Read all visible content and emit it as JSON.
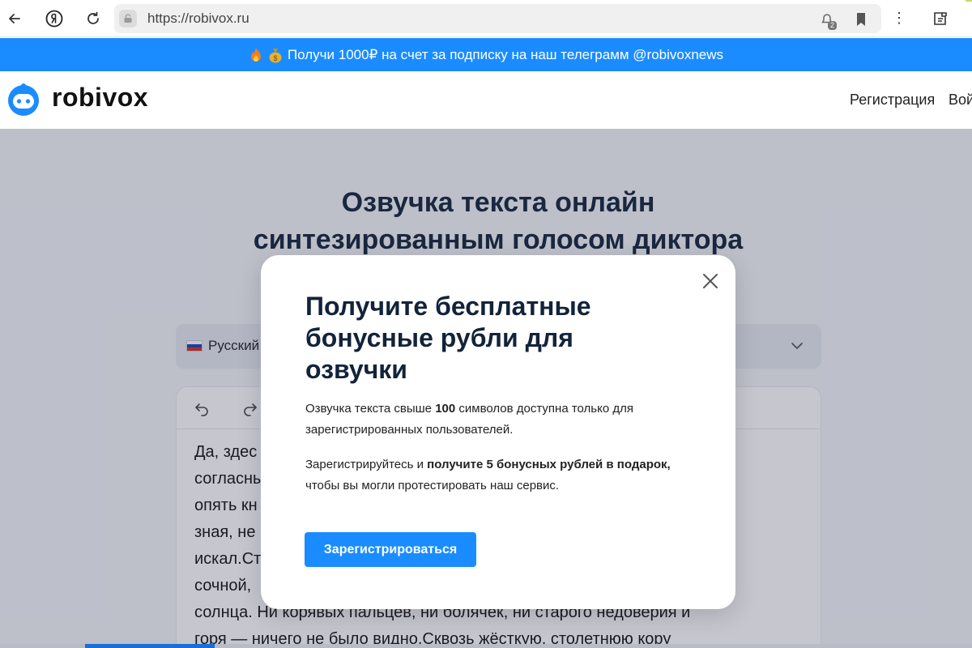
{
  "browser": {
    "url": "https://robivox.ru",
    "notif_count": "2",
    "menu_glyph": "⋮"
  },
  "promo": {
    "text": "Получи 1000₽ на счет за подписку на наш телеграмм @robivoxnews"
  },
  "header": {
    "logo_text": "robivox",
    "nav": [
      "Регистрация",
      "Вой"
    ]
  },
  "hero": {
    "title_line1": "Озвучка текста онлайн",
    "title_line2": "синтезированным голосом диктора"
  },
  "language_select": {
    "selected": "Русский"
  },
  "editor": {
    "text": "Да, здес\nсогласны\nопять кн                                                                                    е\nзная, не\nискал.Ст\nсочной, \nсолнца. Ни корявых пальцев, ни болячек, ни старого недоверия и\nгоря — ничего не было видно.Сквозь жёсткую, столетнюю кору"
  },
  "modal": {
    "title": "Получите бесплатные бонусные рубли для озвучки",
    "p1_before": "Озвучка текста свыше ",
    "p1_bold": "100",
    "p1_after": " символов доступна только для зарегистрированных пользователей.",
    "p2_before": "Зарегистрируйтесь и ",
    "p2_bold": "получите 5 бонусных рублей в подарок,",
    "p2_after": " чтобы вы могли протестировать наш сервис.",
    "button": "Зарегистрироваться"
  },
  "colors": {
    "accent": "#1a8cff",
    "title": "#12233a"
  }
}
